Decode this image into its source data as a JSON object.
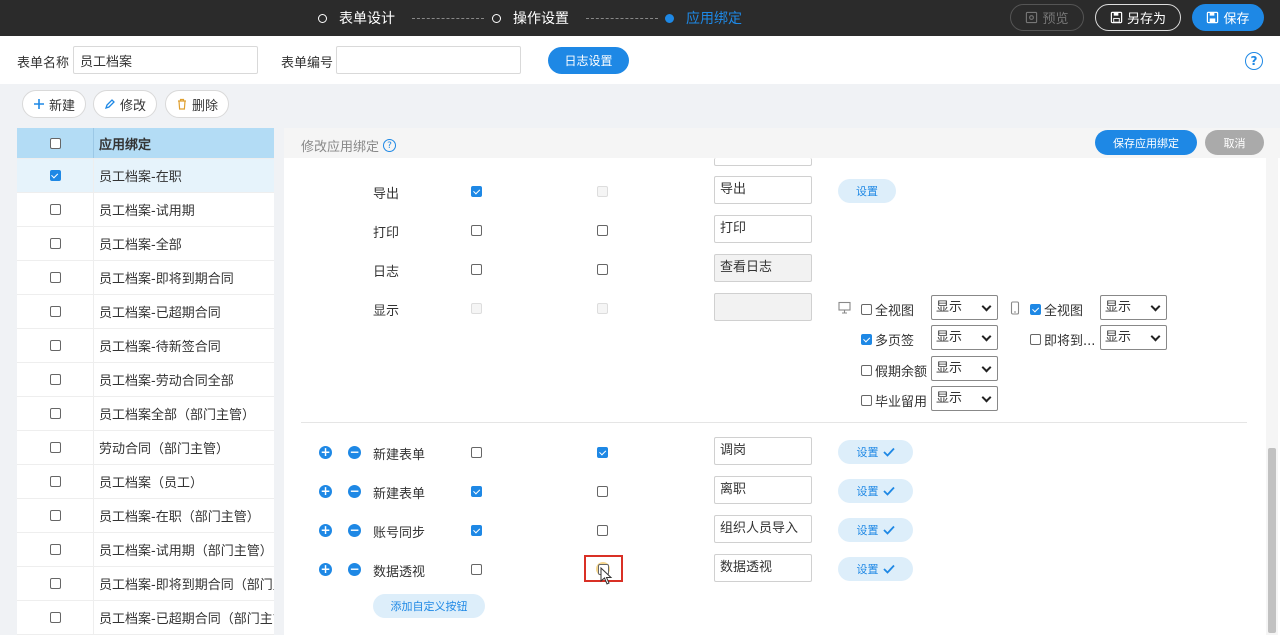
{
  "steps": [
    {
      "label": "表单设计",
      "active": false
    },
    {
      "label": "操作设置",
      "active": false
    },
    {
      "label": "应用绑定",
      "active": true
    }
  ],
  "top_buttons": {
    "preview": "预览",
    "save_as": "另存为",
    "save": "保存"
  },
  "form": {
    "name_label": "表单名称",
    "name_value": "员工档案",
    "code_label": "表单编号",
    "code_value": "",
    "log_button": "日志设置"
  },
  "toolbar": {
    "new": "新建",
    "edit": "修改",
    "delete": "删除"
  },
  "left_list": {
    "header": "应用绑定",
    "items": [
      {
        "label": "员工档案-在职",
        "checked": true
      },
      {
        "label": "员工档案-试用期",
        "checked": false
      },
      {
        "label": "员工档案-全部",
        "checked": false
      },
      {
        "label": "员工档案-即将到期合同",
        "checked": false
      },
      {
        "label": "员工档案-已超期合同",
        "checked": false
      },
      {
        "label": "员工档案-待新签合同",
        "checked": false
      },
      {
        "label": "员工档案-劳动合同全部",
        "checked": false
      },
      {
        "label": "员工档案全部（部门主管）",
        "checked": false
      },
      {
        "label": "劳动合同（部门主管）",
        "checked": false
      },
      {
        "label": "员工档案（员工）",
        "checked": false
      },
      {
        "label": "员工档案-在职（部门主管）",
        "checked": false
      },
      {
        "label": "员工档案-试用期（部门主管）",
        "checked": false
      },
      {
        "label": "员工档案-即将到期合同（部门主",
        "checked": false
      },
      {
        "label": "员工档案-已超期合同（部门主管",
        "checked": false
      }
    ]
  },
  "panel": {
    "title": "修改应用绑定",
    "save_bind": "保存应用绑定",
    "cancel": "取消",
    "set_label": "设置",
    "add_custom": "添加自定义按钮",
    "rows": [
      {
        "label": "导出",
        "c1": true,
        "c2": null,
        "text": "导出",
        "has_set": true
      },
      {
        "label": "打印",
        "c1": false,
        "c2": false,
        "text": "打印",
        "has_set": false
      },
      {
        "label": "日志",
        "c1": false,
        "c2": false,
        "text": "查看日志",
        "has_set": false
      },
      {
        "label": "显示",
        "c1": null,
        "c2": null,
        "text": "",
        "has_set": false
      }
    ],
    "display_options": {
      "desktop_icon": "monitor-icon",
      "mobile_icon": "mobile-icon",
      "left": [
        {
          "label": "全视图",
          "checked": false,
          "value": "显示"
        },
        {
          "label": "多页签",
          "checked": true,
          "value": "显示"
        },
        {
          "label": "假期余额",
          "checked": false,
          "value": "显示"
        },
        {
          "label": "毕业留用",
          "checked": false,
          "value": "显示"
        }
      ],
      "right": [
        {
          "label": "全视图",
          "checked": true,
          "value": "显示"
        },
        {
          "label": "即将到...",
          "checked": false,
          "value": "显示"
        }
      ]
    },
    "custom_rows": [
      {
        "label": "新建表单",
        "c1": false,
        "c2": true,
        "text": "调岗"
      },
      {
        "label": "新建表单",
        "c1": true,
        "c2": false,
        "text": "离职"
      },
      {
        "label": "账号同步",
        "c1": true,
        "c2": false,
        "text": "组织人员导入"
      },
      {
        "label": "数据透视",
        "c1": false,
        "c2": false,
        "text": "数据透视"
      }
    ]
  },
  "colors": {
    "accent": "#1e88e5",
    "topbar": "#2b2b2b",
    "highlight": "#d93025"
  }
}
